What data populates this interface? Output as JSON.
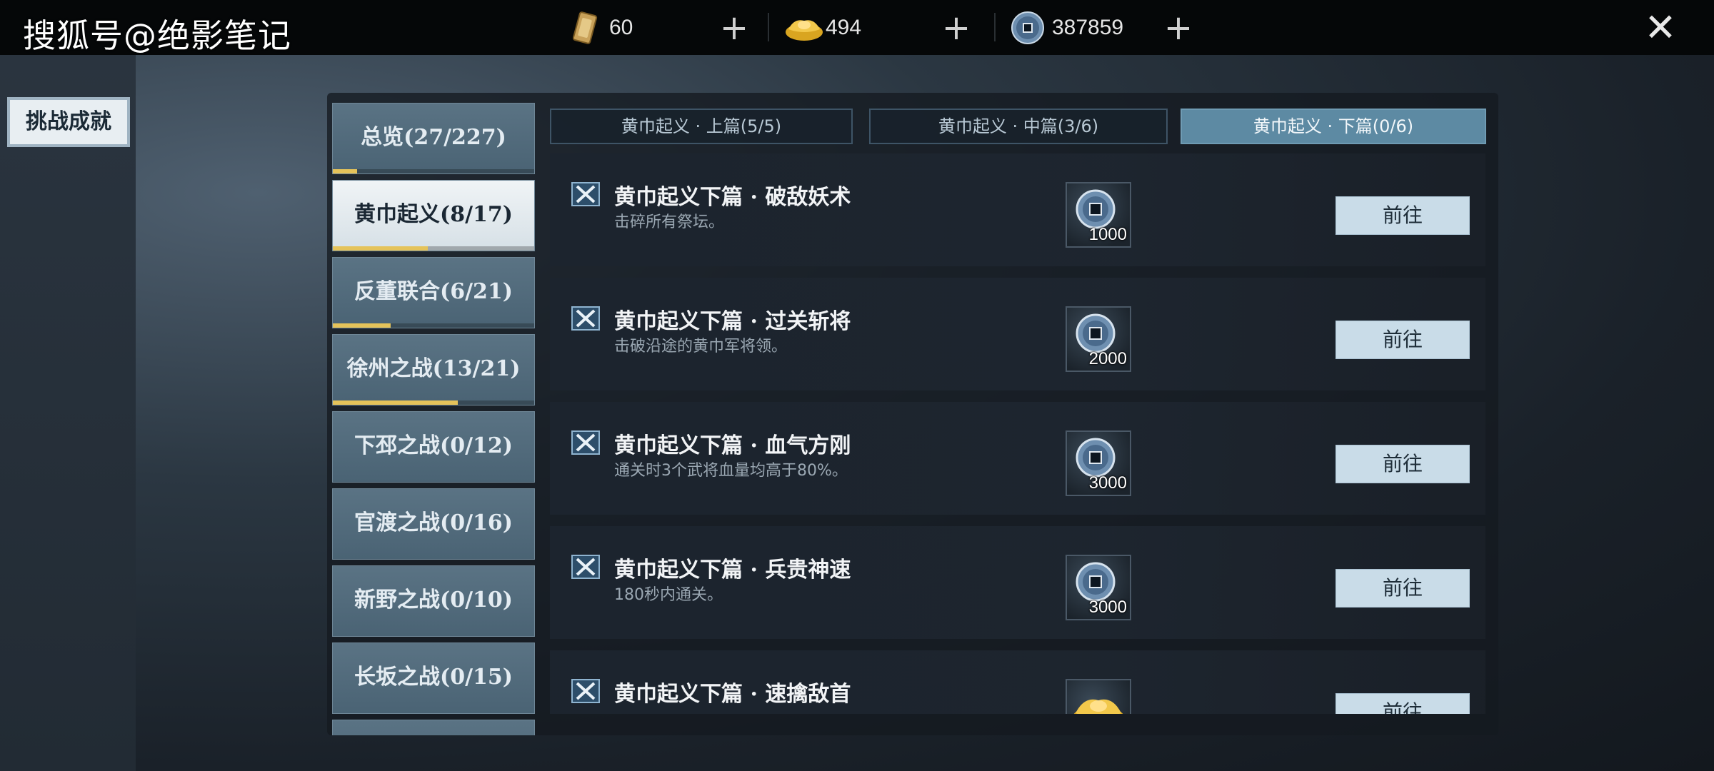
{
  "watermark": "搜狐号@绝影笔记",
  "currencies": [
    {
      "icon": "token-card-icon",
      "value": "60"
    },
    {
      "icon": "gold-ingot-icon",
      "value": "494"
    },
    {
      "icon": "copper-coin-icon",
      "value": "387859"
    }
  ],
  "plus_label": "+",
  "close_label": "✕",
  "side_tab": "挑战成就",
  "categories": [
    {
      "label": "总览(27/227)",
      "progress": 0.119,
      "active": false
    },
    {
      "label": "黄巾起义(8/17)",
      "progress": 0.47,
      "active": true
    },
    {
      "label": "反董联合(6/21)",
      "progress": 0.286,
      "active": false
    },
    {
      "label": "徐州之战(13/21)",
      "progress": 0.619,
      "active": false
    },
    {
      "label": "下邳之战(0/12)",
      "progress": 0,
      "active": false
    },
    {
      "label": "官渡之战(0/16)",
      "progress": 0,
      "active": false
    },
    {
      "label": "新野之战(0/10)",
      "progress": 0,
      "active": false
    },
    {
      "label": "长坂之战(0/15)",
      "progress": 0,
      "active": false
    }
  ],
  "sub_tabs": [
    {
      "label": "黄巾起义 · 上篇(5/5)",
      "active": false
    },
    {
      "label": "黄巾起义 · 中篇(3/6)",
      "active": false
    },
    {
      "label": "黄巾起义 · 下篇(0/6)",
      "active": true
    }
  ],
  "tasks": [
    {
      "title": "黄巾起义下篇 · 破敌妖术",
      "desc": "击碎所有祭坛。",
      "reward_icon": "copper-coin-icon",
      "reward_qty": "1000",
      "button": "前往"
    },
    {
      "title": "黄巾起义下篇 · 过关斩将",
      "desc": "击破沿途的黄巾军将领。",
      "reward_icon": "copper-coin-icon",
      "reward_qty": "2000",
      "button": "前往"
    },
    {
      "title": "黄巾起义下篇 · 血气方刚",
      "desc": "通关时3个武将血量均高于80%。",
      "reward_icon": "copper-coin-icon",
      "reward_qty": "3000",
      "button": "前往"
    },
    {
      "title": "黄巾起义下篇 · 兵贵神速",
      "desc": "180秒内通关。",
      "reward_icon": "copper-coin-icon",
      "reward_qty": "3000",
      "button": "前往"
    },
    {
      "title": "黄巾起义下篇 · 速擒敌首",
      "desc": "",
      "reward_icon": "gold-ingot-icon",
      "reward_qty": "",
      "button": "前往"
    }
  ],
  "colors": {
    "accent": "#5d8aa3",
    "progress": "#e5c35a",
    "button": "#c9dce8"
  }
}
